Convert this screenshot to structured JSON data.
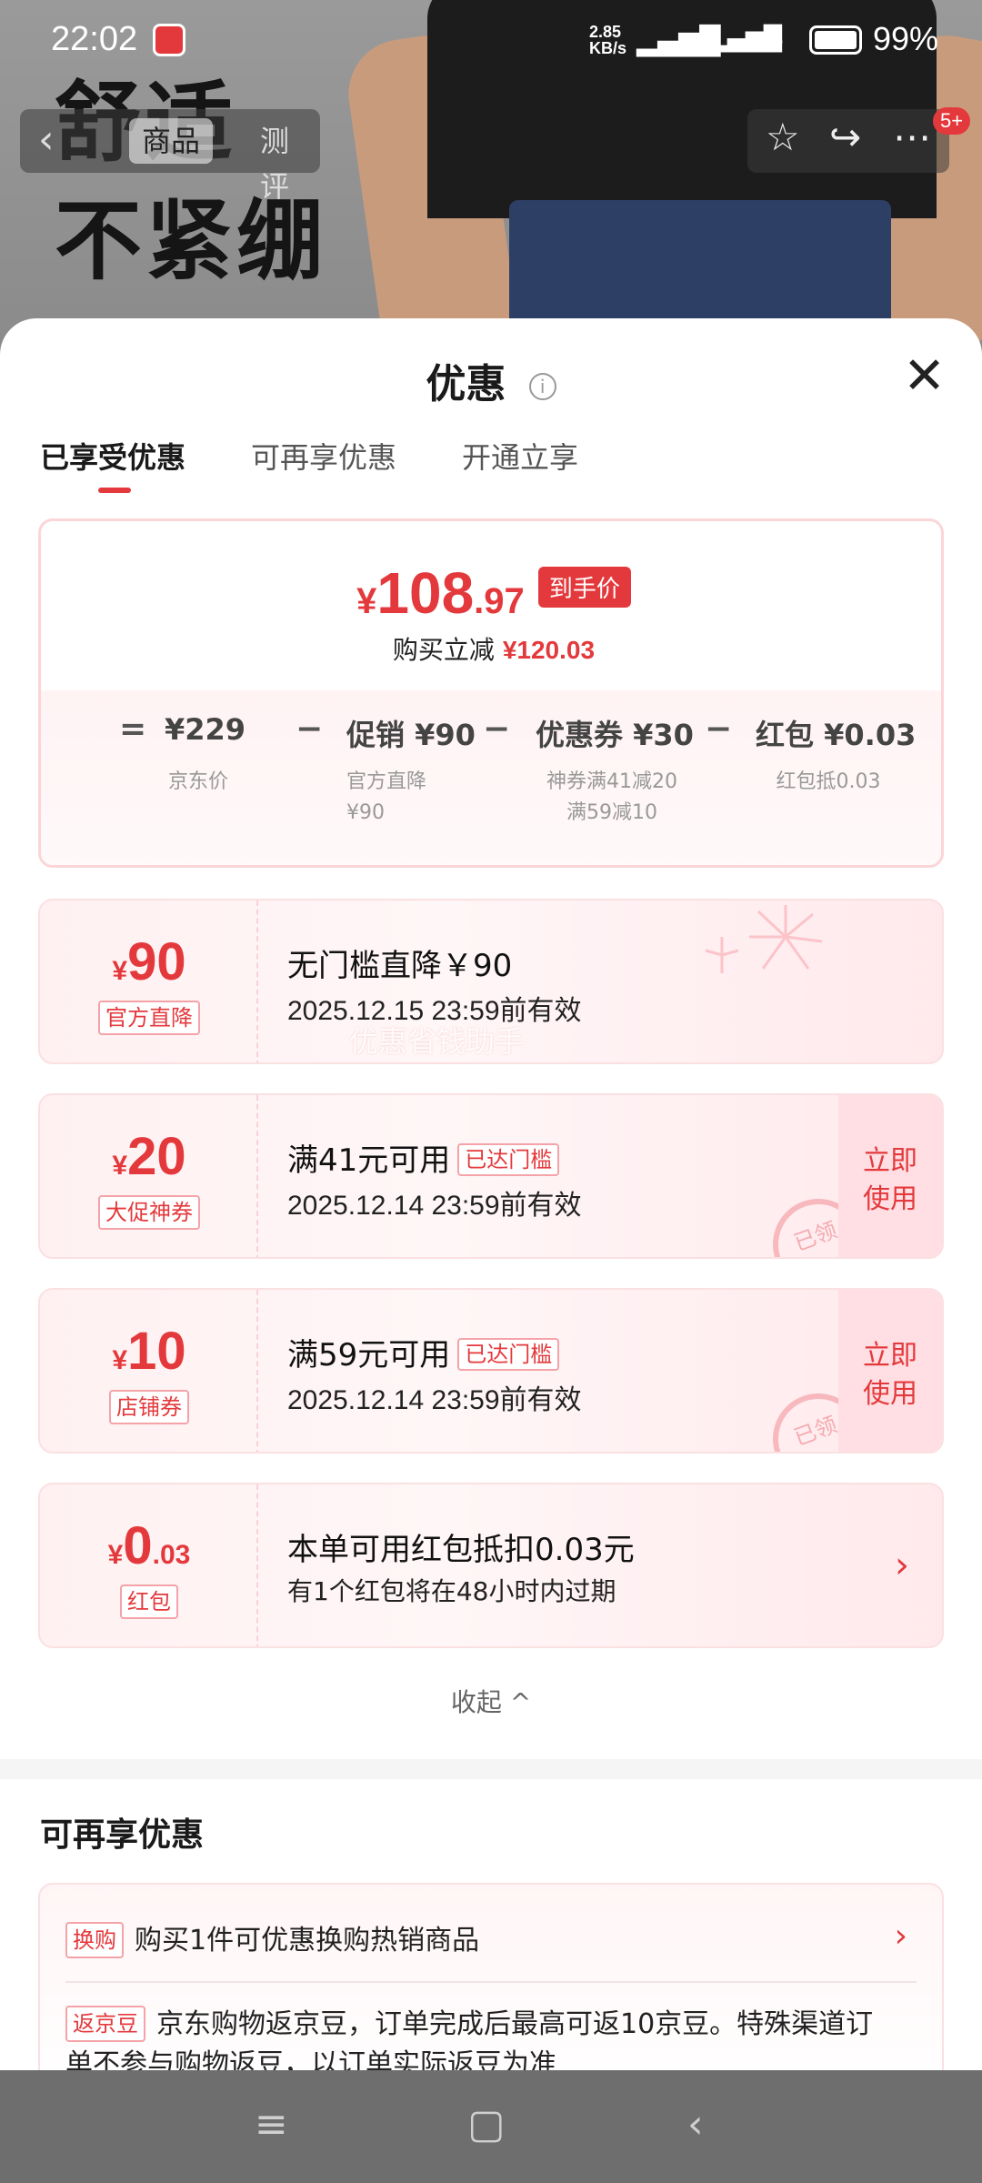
{
  "status_bar": {
    "time": "22:02",
    "net_speed_top": "2.85",
    "net_speed_bottom": "KB/s",
    "signal_1": "5G",
    "signal_2": "5G",
    "battery_pct": "99%"
  },
  "hero": {
    "headline_line1": "舒适",
    "headline_line2": "不紧绷"
  },
  "top_nav": {
    "tab_product": "商品",
    "tab_review": "测评",
    "message_badge": "5+"
  },
  "sheet": {
    "title": "优惠",
    "info_icon": "i",
    "close_icon": "close-icon",
    "tabs": [
      "已享受优惠",
      "可再享优惠",
      "开通立享"
    ]
  },
  "summary": {
    "yen": "¥",
    "price_int": "108",
    "price_dec": ".97",
    "price_tag": "到手价",
    "save_prefix": "购买立减",
    "save_amount": "¥120.03",
    "formula": {
      "op_eq": "=",
      "jd_price": "¥229",
      "op1": "−",
      "promo": "促销 ¥90",
      "op2": "−",
      "coupon": "优惠券 ¥30",
      "op3": "−",
      "redpack": "红包 ¥0.03"
    },
    "sub": {
      "jd_price_label": "京东价",
      "promo_label_1": "官方直降",
      "promo_label_2": "¥90",
      "coupon_label_1": "神券满41减20",
      "coupon_label_2": "满59减10",
      "redpack_label": "红包抵0.03"
    }
  },
  "coupons": [
    {
      "yen": "¥",
      "amount": "90",
      "dec": "",
      "kind": "官方直降",
      "title": "无门槛直降￥90",
      "chip": "",
      "date": "2025.12.15 23:59前有效",
      "action": ""
    },
    {
      "yen": "¥",
      "amount": "20",
      "dec": "",
      "kind": "大促神券",
      "title": "满41元可用",
      "chip": "已达门槛",
      "date": "2025.12.14 23:59前有效",
      "action_1": "立即",
      "action_2": "使用",
      "stamp": "已领"
    },
    {
      "yen": "¥",
      "amount": "10",
      "dec": "",
      "kind": "店铺券",
      "title": "满59元可用",
      "chip": "已达门槛",
      "date": "2025.12.14 23:59前有效",
      "action_1": "立即",
      "action_2": "使用",
      "stamp": "已领"
    },
    {
      "yen": "¥",
      "amount": "0",
      "dec": ".03",
      "kind": "红包",
      "title": "本单可用红包抵扣0.03元",
      "chip": "",
      "date": "有1个红包将在48小时内过期",
      "arrow": "›"
    }
  ],
  "watermark": "优惠省钱助手",
  "collapse_label": "收起 ^",
  "more_section": {
    "title": "可再享优惠",
    "rows": [
      {
        "tag": "换购",
        "text": "购买1件可优惠换购热销商品",
        "arrow": "›"
      },
      {
        "tag": "返京豆",
        "text": "京东购物返京豆，订单完成后最高可返10京豆。特殊渠道订",
        "text2": "单不参与购物返豆，以订单实际返豆为准"
      }
    ]
  },
  "system_nav": {
    "menu_icon": "≡",
    "home_icon": "▢",
    "back_icon": "‹"
  },
  "colors": {
    "accent": "#e4393c",
    "card_border": "#fbe0e2"
  }
}
